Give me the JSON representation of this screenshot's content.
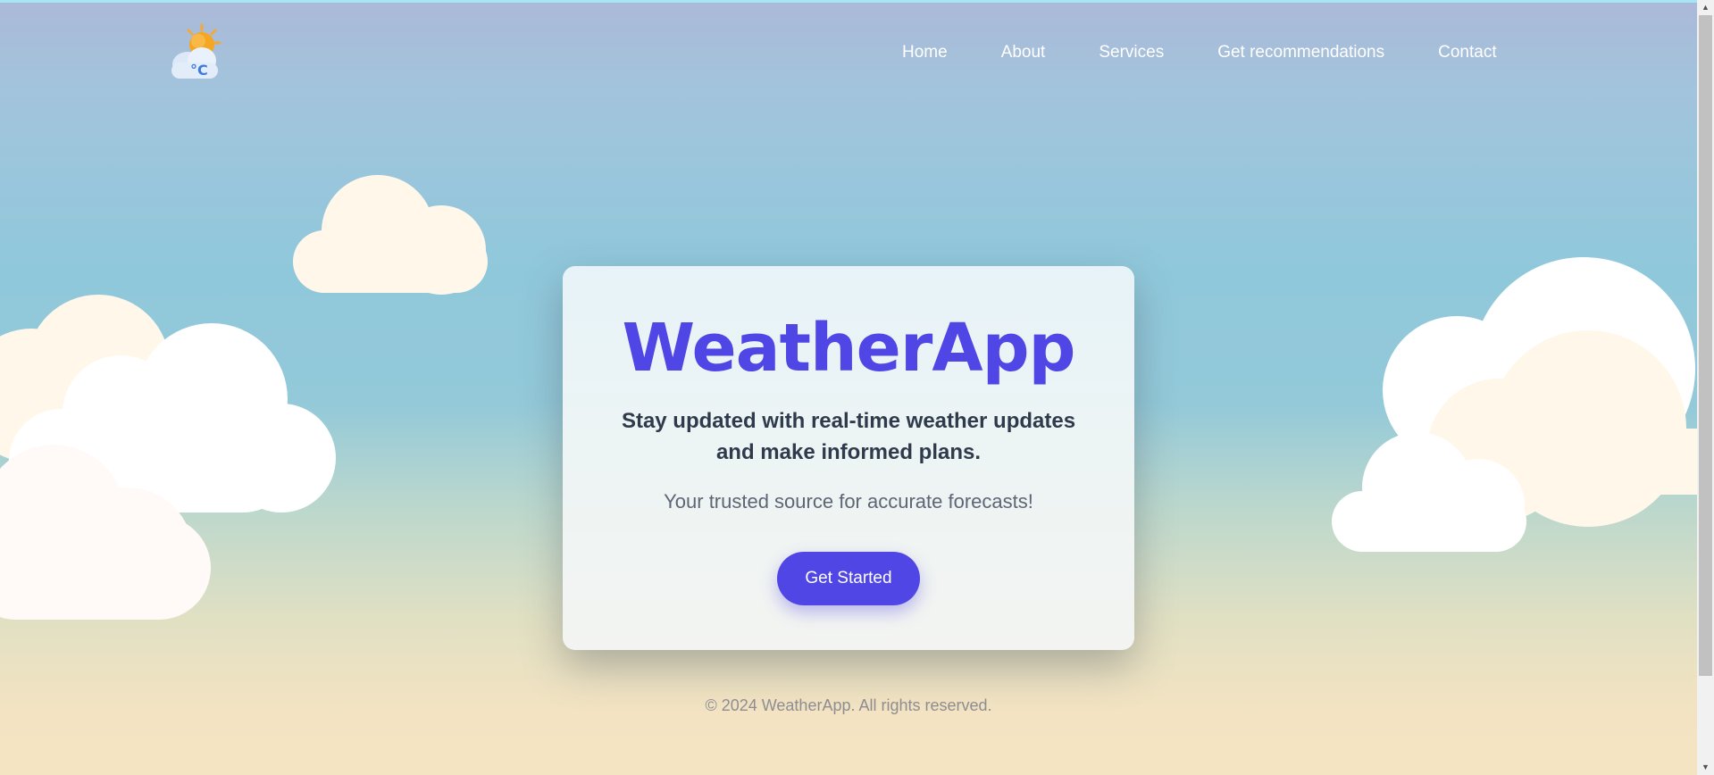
{
  "nav": {
    "logo_icon": "weather-partly-cloudy-celsius-icon",
    "logo_text": "°C",
    "items": [
      {
        "label": "Home"
      },
      {
        "label": "About"
      },
      {
        "label": "Services"
      },
      {
        "label": "Get recommendations"
      },
      {
        "label": "Contact"
      }
    ]
  },
  "hero": {
    "title": "WeatherApp",
    "subtitle": "Stay updated with real-time weather updates and make informed plans.",
    "tagline": "Your trusted source for accurate forecasts!",
    "cta_label": "Get Started"
  },
  "footer": {
    "text": "© 2024 WeatherApp. All rights reserved."
  },
  "colors": {
    "accent": "#4f46e5",
    "sky_top": "#abb9d8",
    "sky_mid": "#90c8db",
    "sky_bottom": "#f5e4c2",
    "cloud_white": "#ffffff",
    "cloud_cream": "#fff8ea"
  }
}
